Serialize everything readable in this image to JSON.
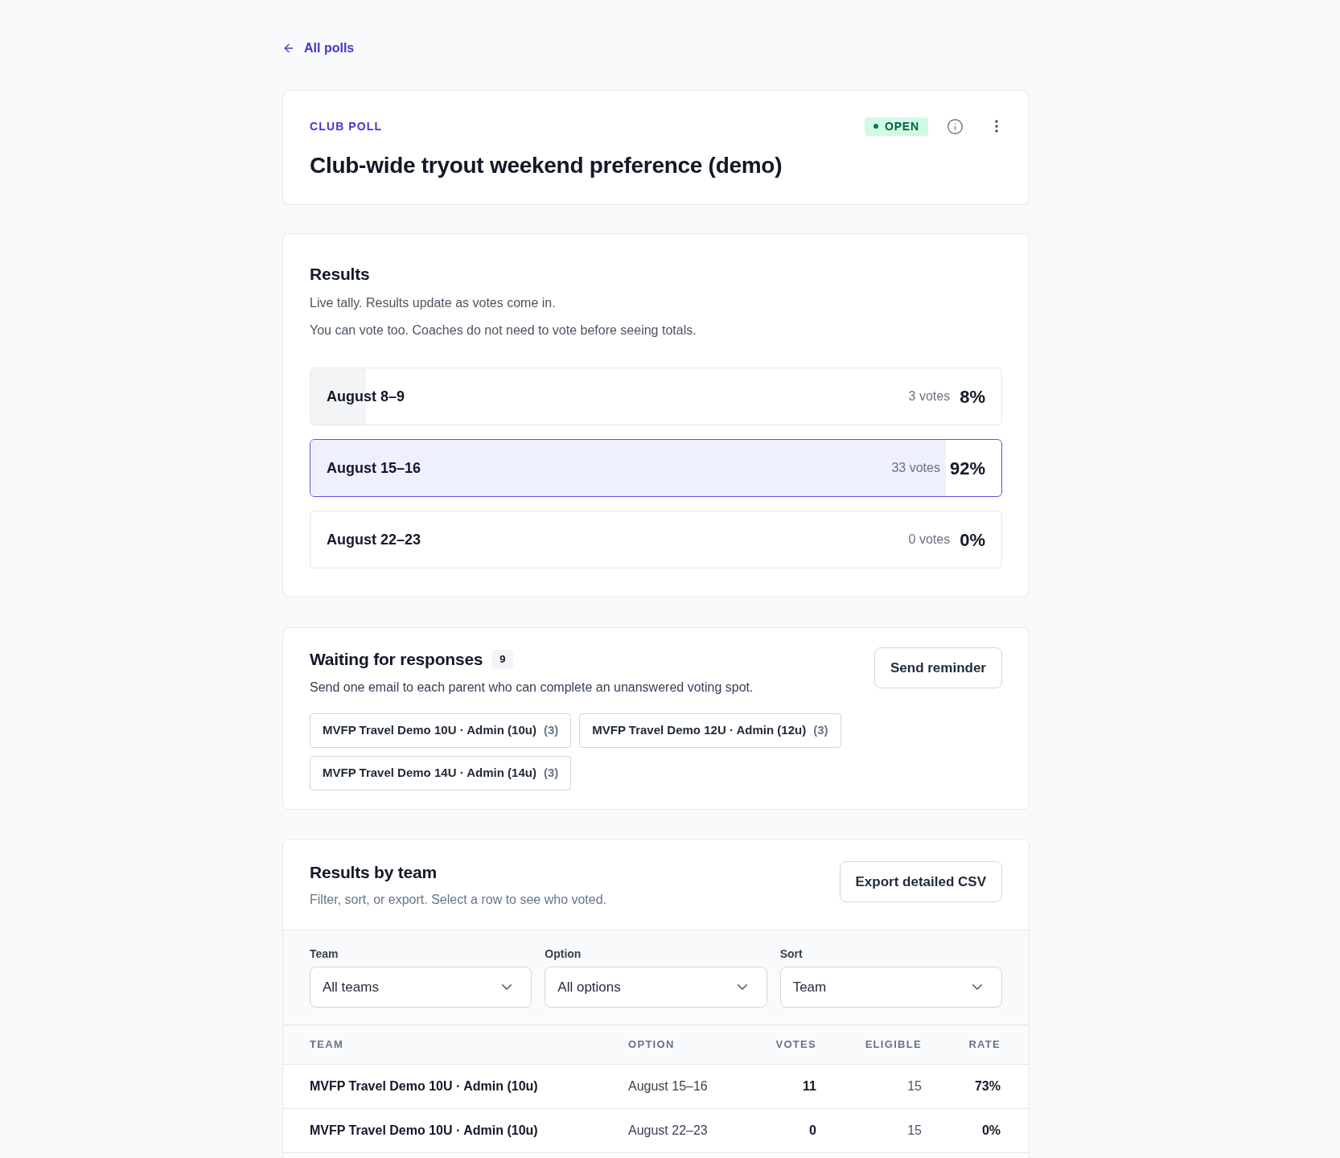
{
  "back_link": {
    "label": "All polls"
  },
  "poll_header": {
    "eyebrow": "CLUB POLL",
    "title": "Club-wide tryout weekend preference (demo)",
    "status": {
      "label": "OPEN",
      "kind": "open"
    }
  },
  "results": {
    "title": "Results",
    "notes": [
      "Live tally. Results update as votes come in.",
      "You can vote too. Coaches do not need to vote before seeing totals."
    ],
    "options": [
      {
        "label": "August 8–9",
        "votes": "3 votes",
        "percent": "8%",
        "level": 0.08,
        "selected": false
      },
      {
        "label": "August 15–16",
        "votes": "33 votes",
        "percent": "92%",
        "level": 0.92,
        "selected": true
      },
      {
        "label": "August 22–23",
        "votes": "0 votes",
        "percent": "0%",
        "level": 0,
        "selected": false
      }
    ]
  },
  "waiting": {
    "title": "Waiting for responses",
    "count": "9",
    "description": "Send one email to each parent who can complete an unanswered voting spot.",
    "button": "Send reminder",
    "teams": [
      {
        "name": "MVFP Travel Demo 10U · Admin (10u)",
        "count": "(3)"
      },
      {
        "name": "MVFP Travel Demo 12U · Admin (12u)",
        "count": "(3)"
      },
      {
        "name": "MVFP Travel Demo 14U · Admin (14u)",
        "count": "(3)"
      }
    ]
  },
  "results_by_team": {
    "title": "Results by team",
    "subtitle": "Filter, sort, or export. Select a row to see who voted.",
    "button": "Export detailed CSV",
    "filters": [
      {
        "label": "Team",
        "value": "All teams"
      },
      {
        "label": "Option",
        "value": "All options"
      },
      {
        "label": "Sort",
        "value": "Team"
      }
    ],
    "table": {
      "columns": [
        "TEAM",
        "OPTION",
        "VOTES",
        "ELIGIBLE",
        "RATE"
      ],
      "rows": [
        {
          "cells": [
            "MVFP Travel Demo 10U · Admin (10u)",
            "August 15–16",
            "11",
            "15",
            "73%"
          ]
        },
        {
          "cells": [
            "MVFP Travel Demo 10U · Admin (10u)",
            "August 22–23",
            "0",
            "15",
            "0%"
          ]
        }
      ]
    }
  }
}
